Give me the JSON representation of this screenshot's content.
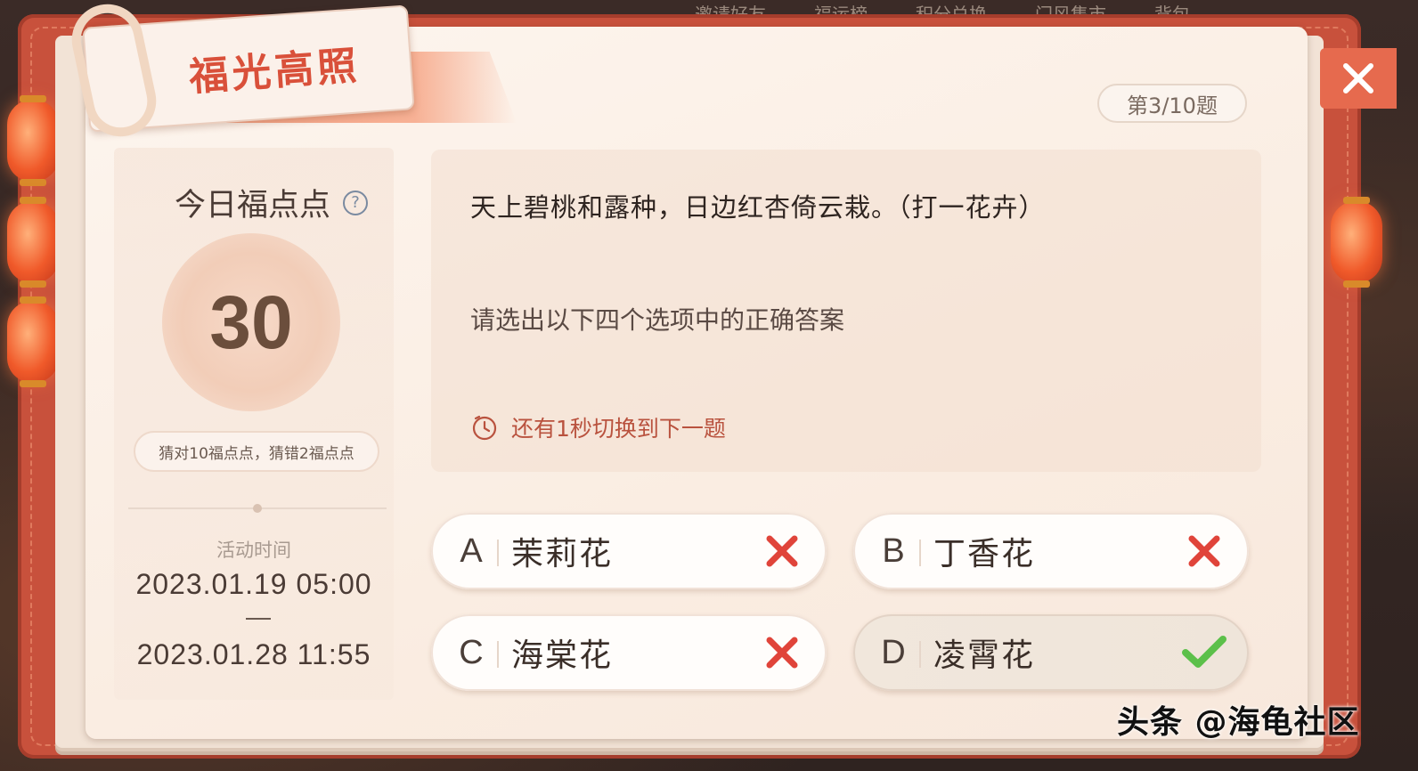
{
  "header": {
    "title": "福光高照",
    "progress": "第3/10题",
    "top_nav": [
      "邀请好友",
      "福运榜",
      "积分兑换",
      "门风集市",
      "背包"
    ]
  },
  "points": {
    "title": "今日福点点",
    "value": "30",
    "rule": "猜对10福点点，猜错2福点点"
  },
  "activity": {
    "label": "活动时间",
    "start": "2023.01.19 05:00",
    "end": "2023.01.28 11:55"
  },
  "question": {
    "riddle": "天上碧桃和露种，日边红杏倚云栽。（打一花卉）",
    "instruction": "请选出以下四个选项中的正确答案",
    "countdown": "还有1秒切换到下一题"
  },
  "options": [
    {
      "letter": "A",
      "text": "茉莉花",
      "result": "wrong"
    },
    {
      "letter": "B",
      "text": "丁香花",
      "result": "wrong"
    },
    {
      "letter": "C",
      "text": "海棠花",
      "result": "wrong"
    },
    {
      "letter": "D",
      "text": "凌霄花",
      "result": "correct"
    }
  ],
  "watermark": "头条 @海龟社区",
  "colors": {
    "accent_red": "#d9503a",
    "wrong_mark": "#e0443a",
    "correct_mark": "#5cc04a",
    "frame": "#c8513c"
  }
}
